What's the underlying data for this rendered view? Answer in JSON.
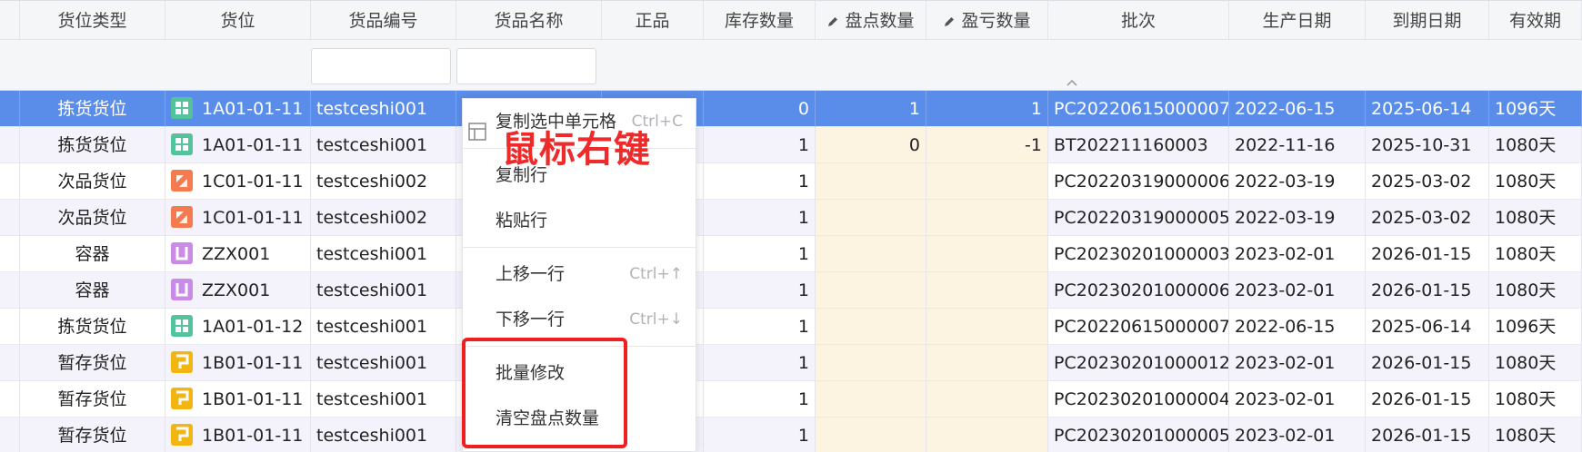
{
  "columns": [
    "货位类型",
    "货位",
    "货品编号",
    "货品名称",
    "正品",
    "库存数量",
    "盘点数量",
    "盈亏数量",
    "批次",
    "生产日期",
    "到期日期",
    "有效期"
  ],
  "filters": {
    "sku_value": "",
    "name_value": ""
  },
  "rows": [
    {
      "type": "拣货货位",
      "slot": "1A01-01-11",
      "icon": "grid-green-icon",
      "sku": "testceshi001",
      "stock": "0",
      "count": "1",
      "diff": "1",
      "batch": "PC20220615000007",
      "mfg": "2022-06-15",
      "exp": "2025-06-14",
      "valid": "1096天"
    },
    {
      "type": "拣货货位",
      "slot": "1A01-01-11",
      "icon": "grid-green-icon",
      "sku": "testceshi001",
      "stock": "1",
      "count": "0",
      "diff": "-1",
      "batch": "BT202211160003",
      "mfg": "2022-11-16",
      "exp": "2025-10-31",
      "valid": "1080天"
    },
    {
      "type": "次品货位",
      "slot": "1C01-01-11",
      "icon": "defect-orange-icon",
      "sku": "testceshi002",
      "stock": "1",
      "count": "",
      "diff": "",
      "batch": "PC20220319000006",
      "mfg": "2022-03-19",
      "exp": "2025-03-02",
      "valid": "1080天"
    },
    {
      "type": "次品货位",
      "slot": "1C01-01-11",
      "icon": "defect-orange-icon",
      "sku": "testceshi002",
      "stock": "1",
      "count": "",
      "diff": "",
      "batch": "PC20220319000005",
      "mfg": "2022-03-19",
      "exp": "2025-03-02",
      "valid": "1080天"
    },
    {
      "type": "容器",
      "slot": "ZZX001",
      "icon": "container-purple-icon",
      "sku": "testceshi001",
      "stock": "1",
      "count": "",
      "diff": "",
      "batch": "PC20230201000003",
      "mfg": "2023-02-01",
      "exp": "2026-01-15",
      "valid": "1080天"
    },
    {
      "type": "容器",
      "slot": "ZZX001",
      "icon": "container-purple-icon",
      "sku": "testceshi001",
      "stock": "1",
      "count": "",
      "diff": "",
      "batch": "PC20230201000006",
      "mfg": "2023-02-01",
      "exp": "2026-01-15",
      "valid": "1080天"
    },
    {
      "type": "拣货货位",
      "slot": "1A01-01-12",
      "icon": "grid-green-icon",
      "sku": "testceshi001",
      "stock": "1",
      "count": "",
      "diff": "",
      "batch": "PC20220615000007",
      "mfg": "2022-06-15",
      "exp": "2025-06-14",
      "valid": "1096天"
    },
    {
      "type": "暂存货位",
      "slot": "1B01-01-11",
      "icon": "staging-yellow-icon",
      "sku": "testceshi001",
      "stock": "1",
      "count": "",
      "diff": "",
      "batch": "PC20230201000012",
      "mfg": "2023-02-01",
      "exp": "2026-01-15",
      "valid": "1080天"
    },
    {
      "type": "暂存货位",
      "slot": "1B01-01-11",
      "icon": "staging-yellow-icon",
      "sku": "testceshi001",
      "stock": "1",
      "count": "",
      "diff": "",
      "batch": "PC20230201000004",
      "mfg": "2023-02-01",
      "exp": "2026-01-15",
      "valid": "1080天"
    },
    {
      "type": "暂存货位",
      "slot": "1B01-01-11",
      "icon": "staging-yellow-icon",
      "sku": "testceshi001",
      "stock": "1",
      "count": "",
      "diff": "",
      "batch": "PC20230201000005",
      "mfg": "2023-02-01",
      "exp": "2026-01-15",
      "valid": "1080天"
    }
  ],
  "context_menu": {
    "copy_cells": "复制选中单元格",
    "copy_cells_shortcut": "Ctrl+C",
    "copy_row": "复制行",
    "paste_row": "粘贴行",
    "move_up": "上移一行",
    "move_up_shortcut": "Ctrl+↑",
    "move_down": "下移一行",
    "move_down_shortcut": "Ctrl+↓",
    "batch_edit": "批量修改",
    "clear_count": "清空盘点数量"
  },
  "annotation": "鼠标右键",
  "colors": {
    "selected_row": "#5a8de9",
    "editable_cell": "#fdf3e1",
    "annotation_red": "#f01f1f",
    "green": "#54c29a",
    "orange": "#f47a4f",
    "purple": "#c98be6",
    "yellow": "#f2b511"
  }
}
